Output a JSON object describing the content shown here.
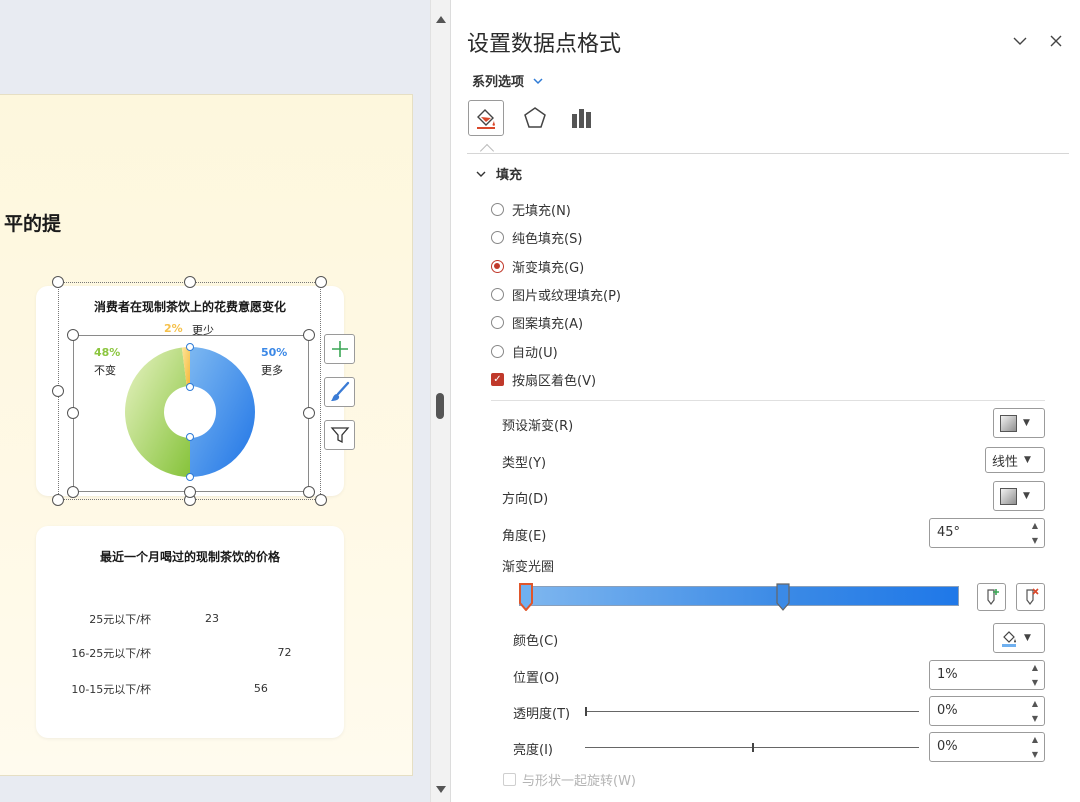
{
  "slide": {
    "title_fragment": "平的提",
    "donut": {
      "title": "消费者在现制茶饮上的花费意愿变化",
      "labels": [
        {
          "pct": "2%",
          "text": "更少",
          "color": "#f6c14b"
        },
        {
          "pct": "48%",
          "text": "不变",
          "color": "#8cc63f"
        },
        {
          "pct": "50%",
          "text": "更多",
          "color": "#3b88e6"
        }
      ]
    },
    "bar_chart_title": "最近一个月喝过的现制茶饮的价格"
  },
  "chart_data": [
    {
      "type": "pie",
      "title": "消费者在现制茶饮上的花费意愿变化",
      "categories": [
        "更多",
        "不变",
        "更少"
      ],
      "values": [
        50,
        48,
        2
      ],
      "colors": [
        "#3b88e6",
        "#8cc63f",
        "#f6c14b"
      ],
      "donut": true
    },
    {
      "type": "bar",
      "orientation": "horizontal",
      "title": "最近一个月喝过的现制茶饮的价格",
      "categories": [
        "25元以下/杯",
        "16-25元以下/杯",
        "10-15元以下/杯"
      ],
      "values": [
        23,
        72,
        56
      ],
      "colors": [
        "#3b88e6",
        "#8cc63f",
        "#f6c14b"
      ],
      "xlim": [
        0,
        100
      ]
    }
  ],
  "pane": {
    "title": "设置数据点格式",
    "series_options": "系列选项",
    "fill_section": "填充",
    "fill_options": [
      {
        "label": "无填充(N)",
        "selected": false
      },
      {
        "label": "纯色填充(S)",
        "selected": false
      },
      {
        "label": "渐变填充(G)",
        "selected": true
      },
      {
        "label": "图片或纹理填充(P)",
        "selected": false
      },
      {
        "label": "图案填充(A)",
        "selected": false
      },
      {
        "label": "自动(U)",
        "selected": false
      }
    ],
    "vary_by_slice": {
      "label": "按扇区着色(V)",
      "checked": true
    },
    "preset_gradient": "预设渐变(R)",
    "type_label": "类型(Y)",
    "type_value": "线性",
    "direction": "方向(D)",
    "angle_label": "角度(E)",
    "angle_value": "45°",
    "gradient_stops": "渐变光圈",
    "color_label": "颜色(C)",
    "position_label": "位置(O)",
    "position_value": "1%",
    "transparency_label": "透明度(T)",
    "transparency_value": "0%",
    "transparency_level": 0,
    "brightness_label": "亮度(I)",
    "brightness_value": "0%",
    "brightness_level": 0,
    "rotate_with_shape": "与形状一起旋转(W)"
  }
}
